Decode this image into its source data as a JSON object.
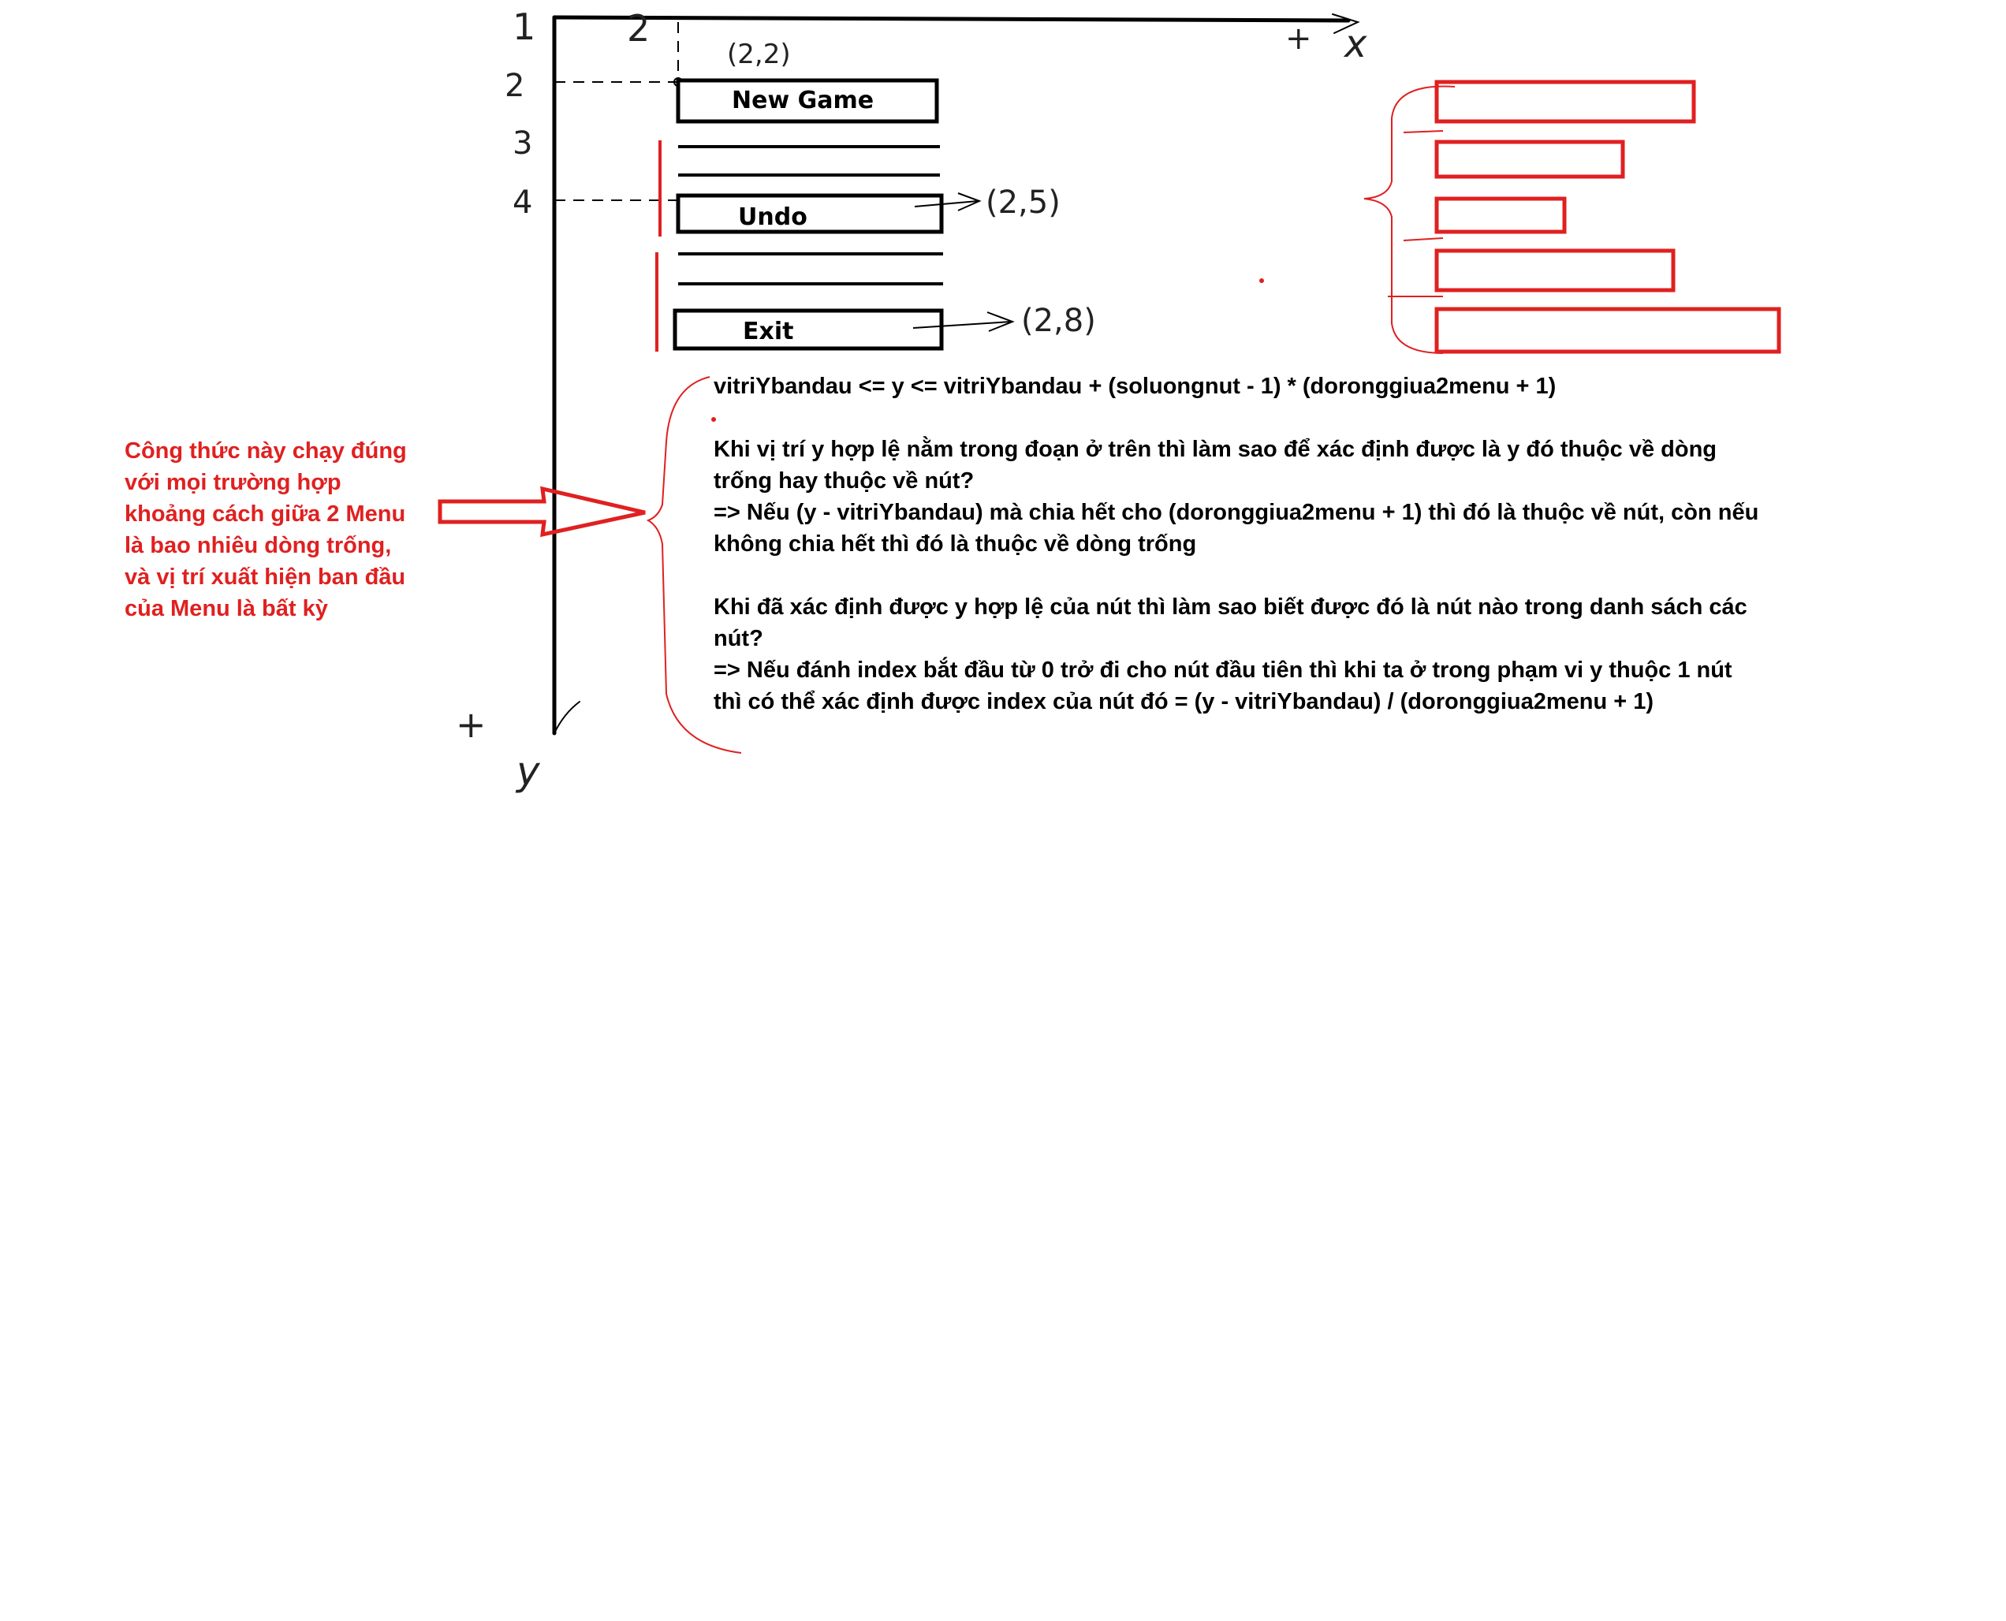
{
  "menu": {
    "new_game": "New Game",
    "undo": "Undo",
    "exit": "Exit"
  },
  "annotations": {
    "axis_x": "x",
    "axis_y": "y",
    "plus_x": "+",
    "plus_y": "+",
    "tick_x_1": "1",
    "tick_x_2": "2",
    "tick_y_2": "2",
    "tick_y_3": "3",
    "tick_y_4": "4",
    "coord_new_game": "(2,2)",
    "coord_undo": "(2,5)",
    "coord_exit": "(2,8)"
  },
  "formula": {
    "line1": "vitriYbandau <= y <= vitriYbandau + (soluongnut - 1) * (doronggiua2menu + 1)",
    "q1": "Khi vị trí y hợp lệ nằm trong đoạn ở trên thì làm sao để xác định được là y đó thuộc về dòng trống hay thuộc về nút?",
    "a1": "=> Nếu (y - vitriYbandau) mà chia hết cho (doronggiua2menu + 1) thì đó là thuộc về nút, còn nếu không chia hết thì đó là thuộc về dòng trống",
    "q2": "Khi đã xác định được y hợp lệ của nút thì làm sao biết được đó là nút nào trong danh sách các nút?",
    "a2": "=> Nếu đánh index bắt đầu từ 0 trở đi cho nút đầu tiên thì khi ta ở trong phạm vi y thuộc 1 nút thì có thể xác định được index của nút  đó = (y - vitriYbandau) / (doronggiua2menu + 1)"
  },
  "note": "Công thức này chạy đúng với mọi trường hợp khoảng cách giữa 2 Menu là bao nhiêu dòng trống, và vị trí xuất hiện ban đầu của Menu là bất kỳ",
  "colors": {
    "ink": "#000000",
    "red": "#e02020"
  }
}
